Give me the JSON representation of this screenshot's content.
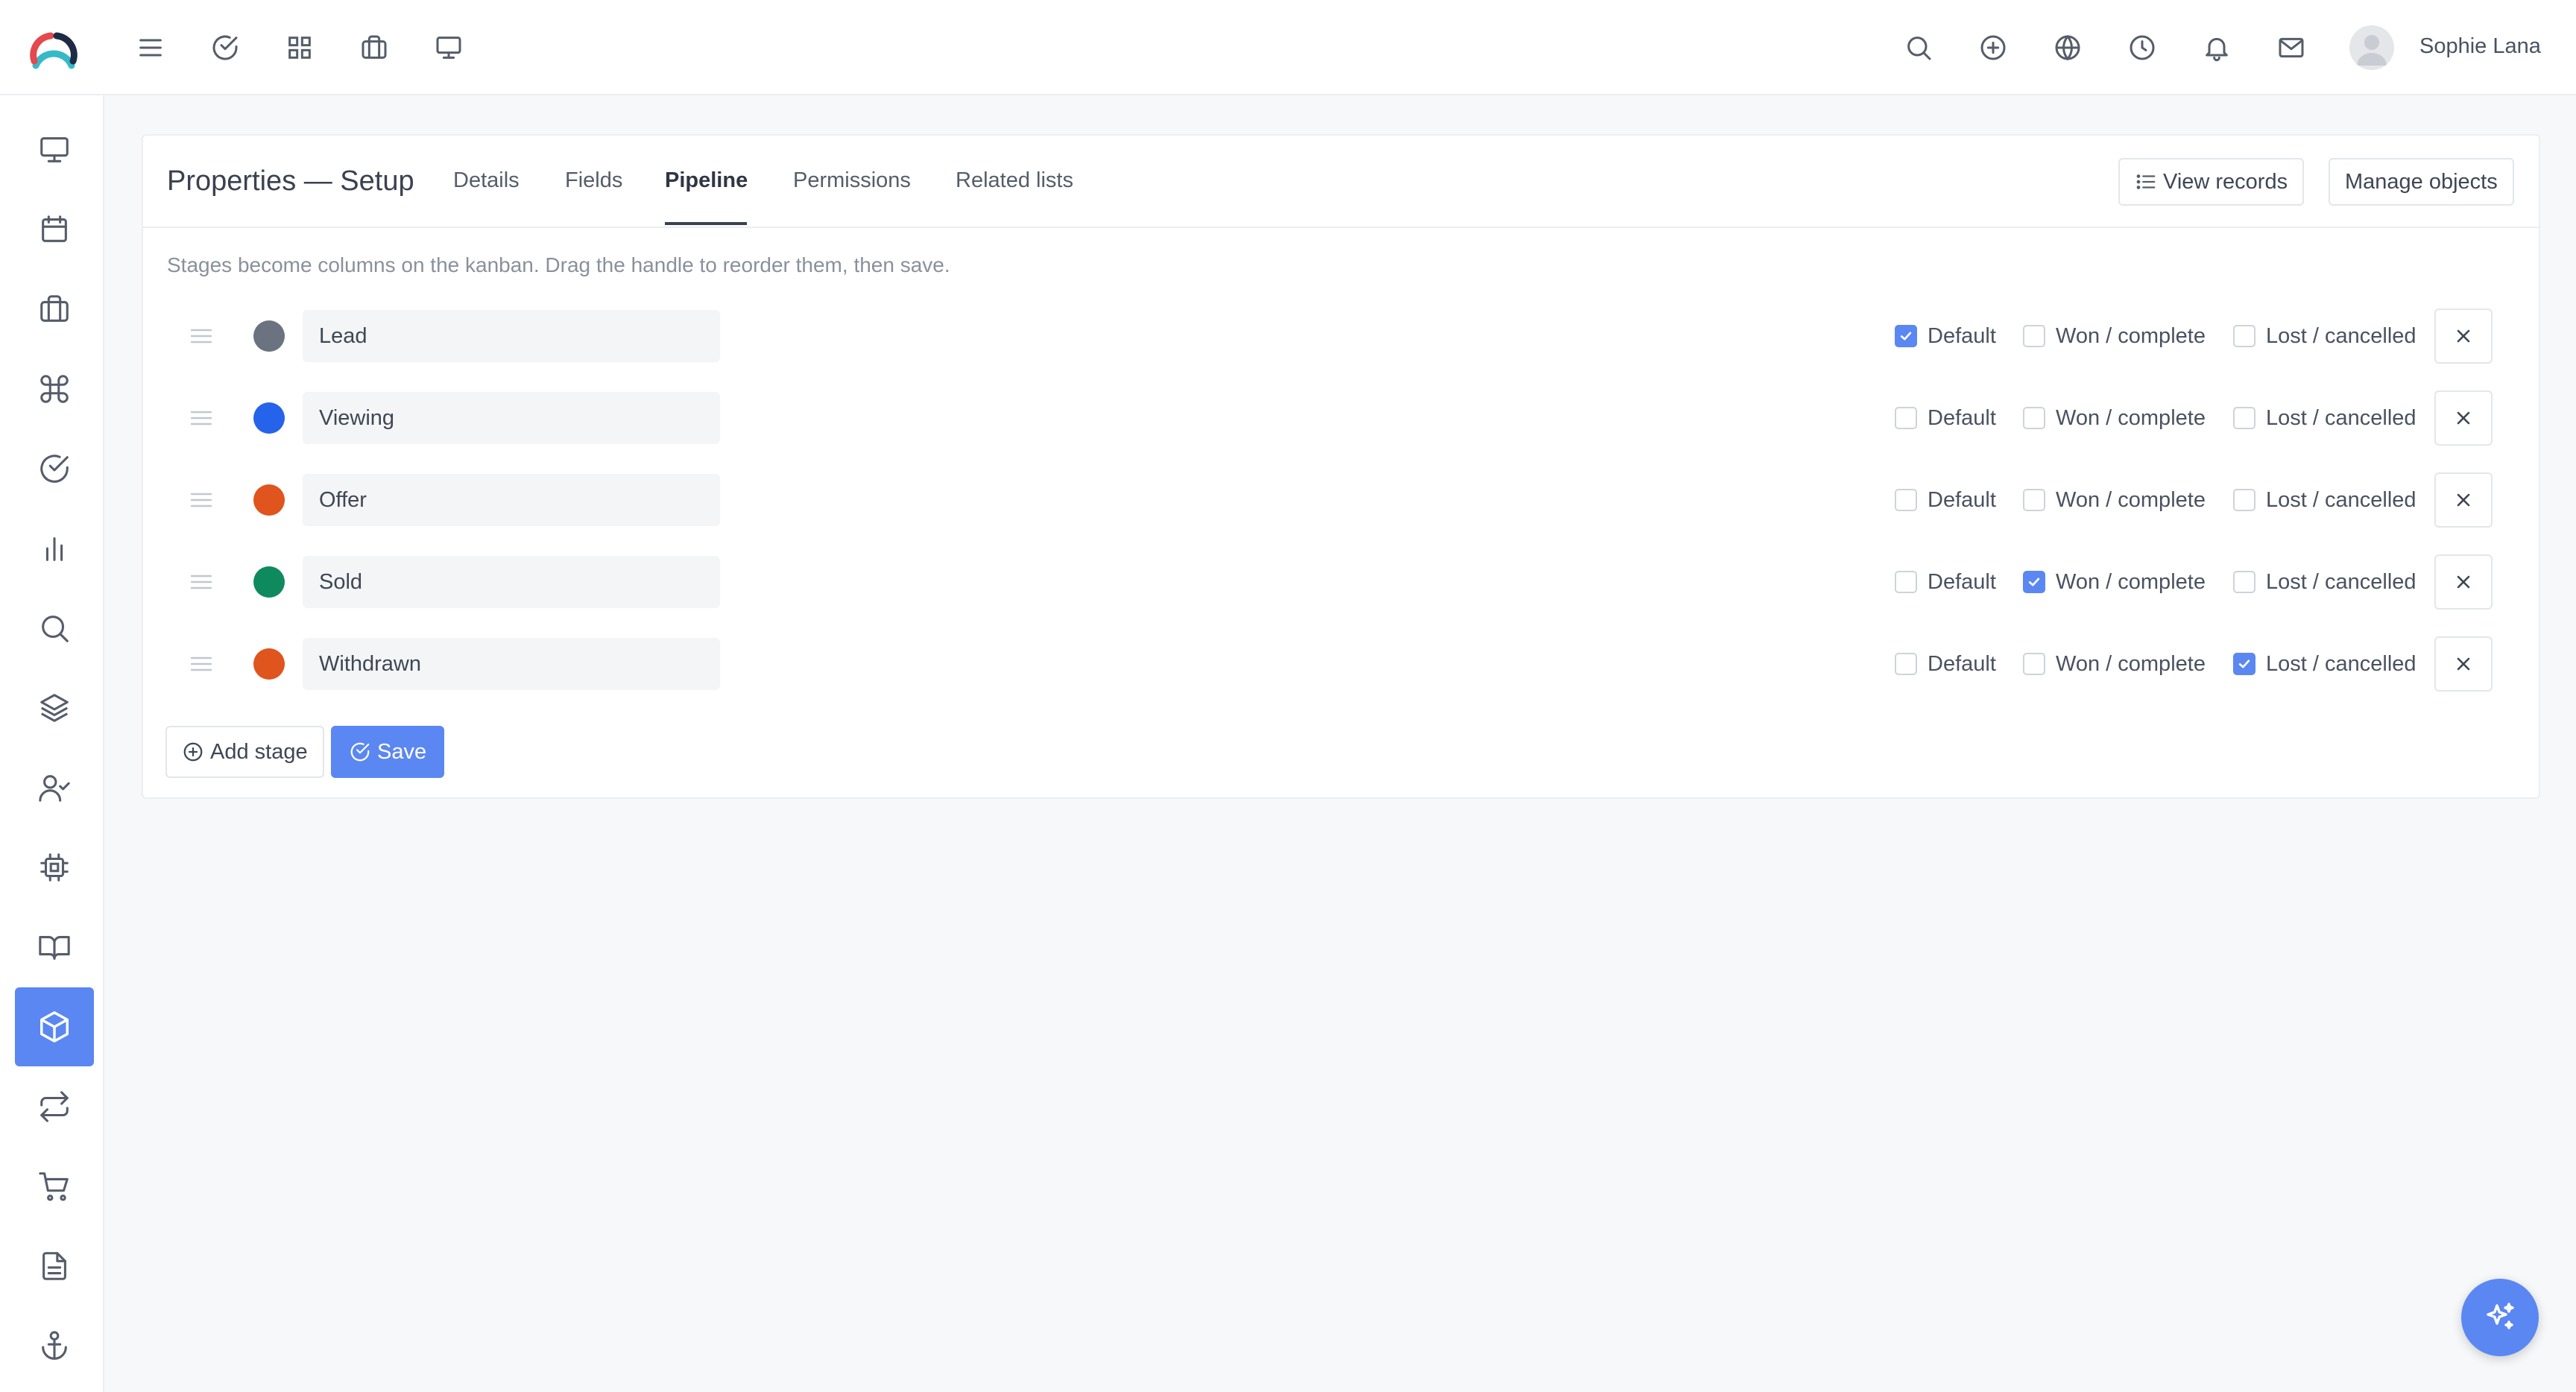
{
  "header": {
    "user_name": "Sophie Lana",
    "nav_icons": [
      "menu-icon",
      "check-circle-icon",
      "grid-icon",
      "briefcase-icon",
      "monitor-icon"
    ],
    "right_icons": [
      "search-icon",
      "plus-circle-icon",
      "globe-icon",
      "clock-icon",
      "bell-icon",
      "mail-icon"
    ]
  },
  "sidebar": {
    "items": [
      {
        "icon": "monitor-icon",
        "active": false
      },
      {
        "icon": "calendar-icon",
        "active": false
      },
      {
        "icon": "briefcase-icon",
        "active": false
      },
      {
        "icon": "command-icon",
        "active": false
      },
      {
        "icon": "check-circle-icon",
        "active": false
      },
      {
        "icon": "bar-chart-icon",
        "active": false
      },
      {
        "icon": "search-icon",
        "active": false
      },
      {
        "icon": "layers-icon",
        "active": false
      },
      {
        "icon": "user-check-icon",
        "active": false
      },
      {
        "icon": "cpu-icon",
        "active": false
      },
      {
        "icon": "book-open-icon",
        "active": false
      },
      {
        "icon": "box-icon",
        "active": true
      },
      {
        "icon": "repeat-icon",
        "active": false
      },
      {
        "icon": "shopping-cart-icon",
        "active": false
      },
      {
        "icon": "file-text-icon",
        "active": false
      },
      {
        "icon": "anchor-icon",
        "active": false
      }
    ]
  },
  "page": {
    "title": "Properties — Setup",
    "tabs": [
      {
        "label": "Details",
        "active": false
      },
      {
        "label": "Fields",
        "active": false
      },
      {
        "label": "Pipeline",
        "active": true
      },
      {
        "label": "Permissions",
        "active": false
      },
      {
        "label": "Related lists",
        "active": false
      }
    ],
    "view_records_label": "View records",
    "manage_objects_label": "Manage objects",
    "hint": "Stages become columns on the kanban. Drag the handle to reorder them, then save."
  },
  "pipeline": {
    "checkbox_labels": {
      "default": "Default",
      "won": "Won / complete",
      "lost": "Lost / cancelled"
    },
    "stages": [
      {
        "name": "Lead",
        "color": "#6b7280",
        "default": true,
        "won": false,
        "lost": false
      },
      {
        "name": "Viewing",
        "color": "#2563eb",
        "default": false,
        "won": false,
        "lost": false
      },
      {
        "name": "Offer",
        "color": "#e0541e",
        "default": false,
        "won": false,
        "lost": false
      },
      {
        "name": "Sold",
        "color": "#0f8a5f",
        "default": false,
        "won": true,
        "lost": false
      },
      {
        "name": "Withdrawn",
        "color": "#e0541e",
        "default": false,
        "won": false,
        "lost": true
      }
    ],
    "add_stage_label": "Add stage",
    "save_label": "Save"
  },
  "colors": {
    "accent": "#5b87f2"
  }
}
